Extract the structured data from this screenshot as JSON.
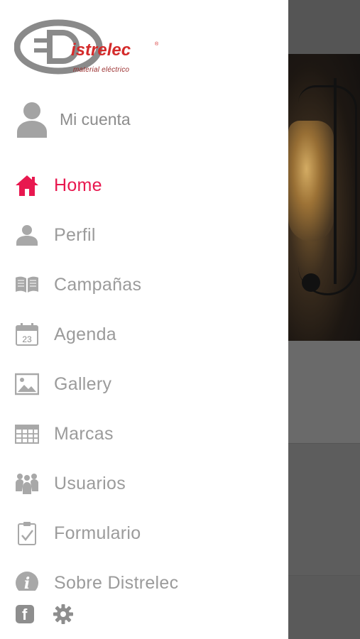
{
  "brand": {
    "logo_text": "Distrelec",
    "tagline": "material eléctrico",
    "accent": "#e8184f"
  },
  "account": {
    "label": "Mi cuenta",
    "icon": "user-avatar-icon"
  },
  "menu": {
    "items": [
      {
        "label": "Home",
        "icon": "home-icon",
        "active": true
      },
      {
        "label": "Perfil",
        "icon": "person-icon",
        "active": false
      },
      {
        "label": "Campañas",
        "icon": "book-icon",
        "active": false
      },
      {
        "label": "Agenda",
        "icon": "calendar-icon",
        "calendar_day": "23",
        "active": false
      },
      {
        "label": "Gallery",
        "icon": "image-icon",
        "active": false
      },
      {
        "label": "Marcas",
        "icon": "table-icon",
        "active": false
      },
      {
        "label": "Usuarios",
        "icon": "users-icon",
        "active": false
      },
      {
        "label": "Formulario",
        "icon": "clipboard-check-icon",
        "active": false
      },
      {
        "label": "Sobre Distrelec",
        "icon": "info-icon",
        "active": false
      }
    ]
  },
  "footer": {
    "facebook_glyph": "f",
    "icons": [
      "facebook-icon",
      "settings-icon"
    ]
  }
}
